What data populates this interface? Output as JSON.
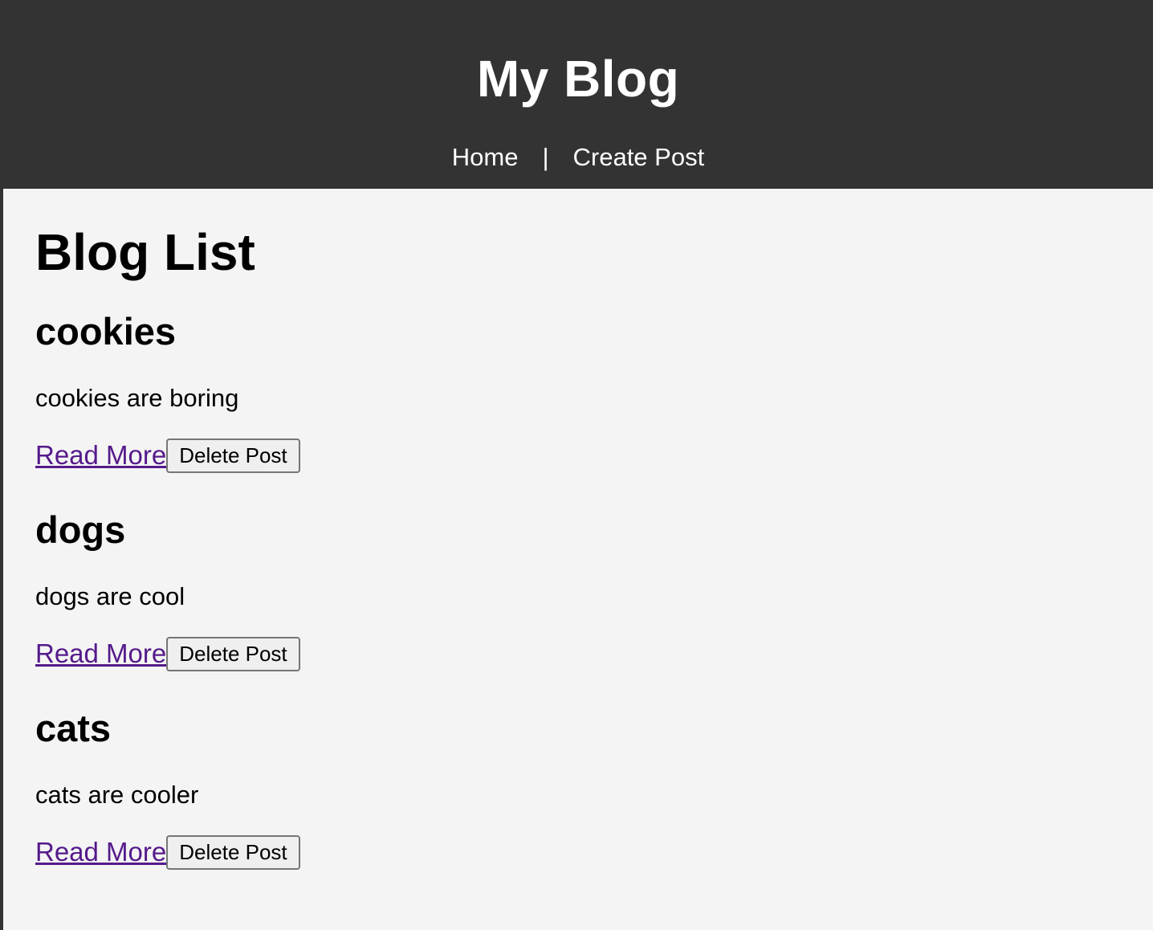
{
  "header": {
    "title": "My Blog",
    "nav": {
      "home": "Home",
      "separator": "|",
      "create": "Create Post"
    }
  },
  "main": {
    "title": "Blog List",
    "posts": [
      {
        "title": "cookies",
        "body": "cookies are boring",
        "read_more": "Read More",
        "delete": "Delete Post"
      },
      {
        "title": "dogs",
        "body": "dogs are cool",
        "read_more": "Read More",
        "delete": "Delete Post"
      },
      {
        "title": "cats",
        "body": "cats are cooler",
        "read_more": "Read More",
        "delete": "Delete Post"
      }
    ]
  },
  "colors": {
    "header_bg": "#333333",
    "page_bg": "#f4f4f4",
    "visited_link": "#551a8b"
  }
}
